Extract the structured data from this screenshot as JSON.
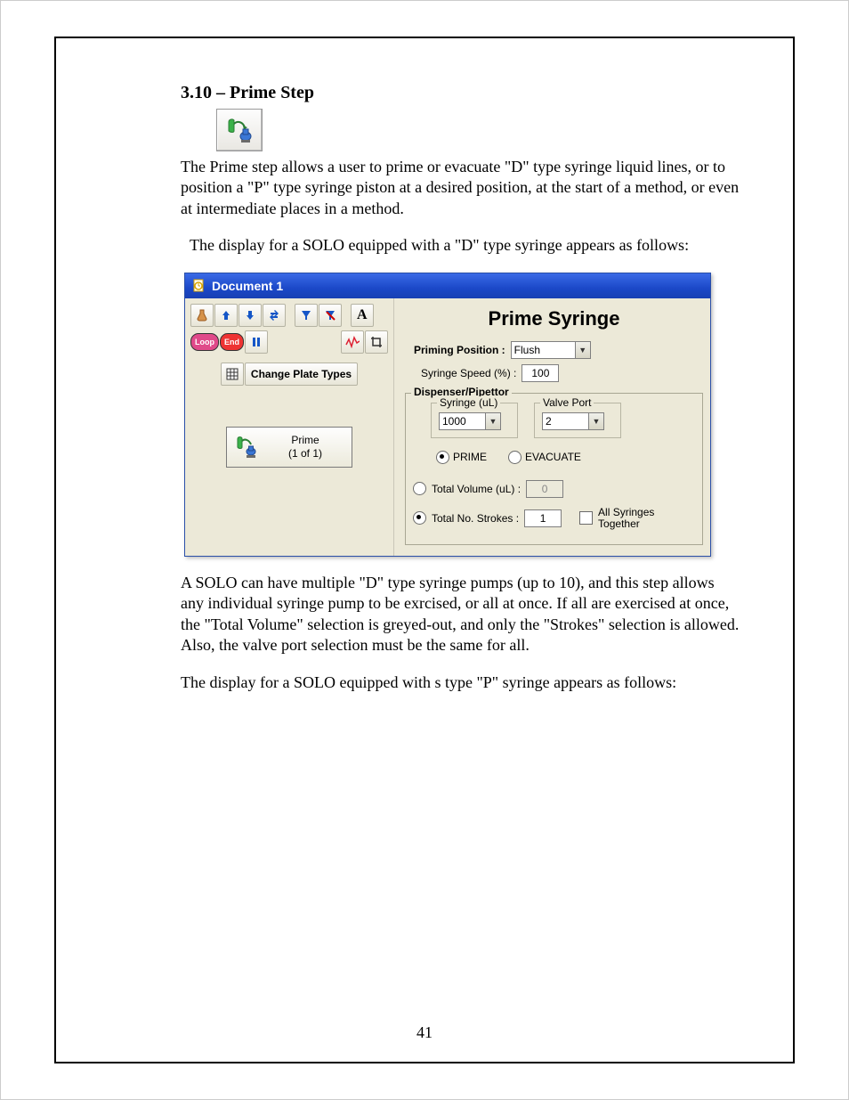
{
  "page": {
    "number": "41",
    "heading": "3.10 – Prime Step",
    "para1": "The Prime step allows a user to prime or evacuate \"D\" type syringe liquid lines, or to position a \"P\" type syringe piston at a desired position, at the start of a method, or even at intermediate places in a method.",
    "para2": "The display for a SOLO equipped with a \"D\" type syringe appears as follows:",
    "para3": "A SOLO can have multiple \"D\" type syringe pumps (up to 10), and this step allows any individual syringe pump to be exrcised, or all at once.  If all are exercised at once, the \"Total Volume\" selection is greyed-out, and only the \"Strokes\" selection is allowed.  Also, the valve port selection must be the same for all.",
    "para4": "The display for a SOLO equipped with s type \"P\" syringe appears as follows:"
  },
  "window": {
    "title": "Document 1",
    "toolbar": {
      "change_plate_types": "Change Plate Types",
      "a_label": "A",
      "loop_label": "Loop",
      "end_label": "End"
    },
    "step_card": {
      "line1": "Prime",
      "line2": "(1 of 1)"
    },
    "panel": {
      "title": "Prime Syringe",
      "priming_position_label": "Priming Position :",
      "priming_position_value": "Flush",
      "syringe_speed_label": "Syringe Speed (%) :",
      "syringe_speed_value": "100",
      "group_title": "Dispenser/Pipettor",
      "syringe_ul_label": "Syringe (uL)",
      "syringe_ul_value": "1000",
      "valve_port_label": "Valve Port",
      "valve_port_value": "2",
      "prime_label": "PRIME",
      "evacuate_label": "EVACUATE",
      "total_volume_label": "Total Volume (uL) :",
      "total_volume_value": "0",
      "total_strokes_label": "Total No. Strokes :",
      "total_strokes_value": "1",
      "all_together_line1": "All Syringes",
      "all_together_line2": "Together"
    }
  }
}
